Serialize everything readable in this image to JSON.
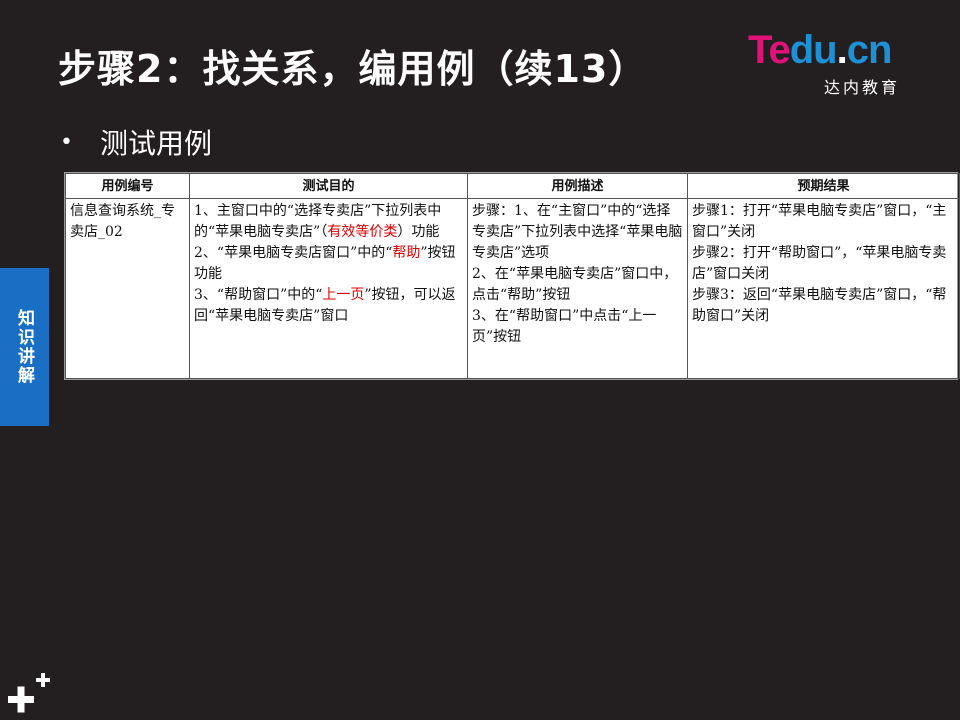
{
  "slide": {
    "title": "步骤2：找关系，编用例（续13）",
    "bullet": "测试用例",
    "side_tab": "知识讲解"
  },
  "logo": {
    "te": "Te",
    "du": "du",
    "dot": ".",
    "cn": "cn",
    "subtitle": "达内教育"
  },
  "table": {
    "headers": [
      "用例编号",
      "测试目的",
      "用例描述",
      "预期结果"
    ],
    "row": {
      "id": "信息查询系统_专卖店_02",
      "purpose": [
        "1、主窗口中的“选择专卖店”下拉列表中的“苹果电脑专卖店”（",
        "有效等价类",
        "）功能",
        "2、“苹果电脑专卖店窗口”中的“",
        "帮助",
        "”按钮功能",
        "3、“帮助窗口”中的“",
        "上一页",
        "”按钮，可以返回“苹果电脑专卖店”窗口"
      ],
      "description": [
        "步骤：1、在“主窗口”中的“选择专卖店”下拉列表中选择“苹果电脑专卖店”选项",
        "2、在“苹果电脑专卖店”窗口中，点击“帮助”按钮",
        "3、在“帮助窗口”中点击“上一页”按钮"
      ],
      "expected": [
        "步骤1：打开“苹果电脑专卖店”窗口，“主窗口”关闭",
        "步骤2：打开“帮助窗口”，“苹果电脑专卖店”窗口关闭",
        "步骤3：返回“苹果电脑专卖店”窗口，“帮助窗口”关闭"
      ]
    }
  },
  "colors": {
    "background": "#231f20",
    "side_tab": "#1a6fc4",
    "highlight": "#e00000",
    "logo_pink": "#e0127a",
    "logo_blue": "#1e90d6"
  },
  "icons": {
    "corner": "plus-cluster-icon"
  }
}
